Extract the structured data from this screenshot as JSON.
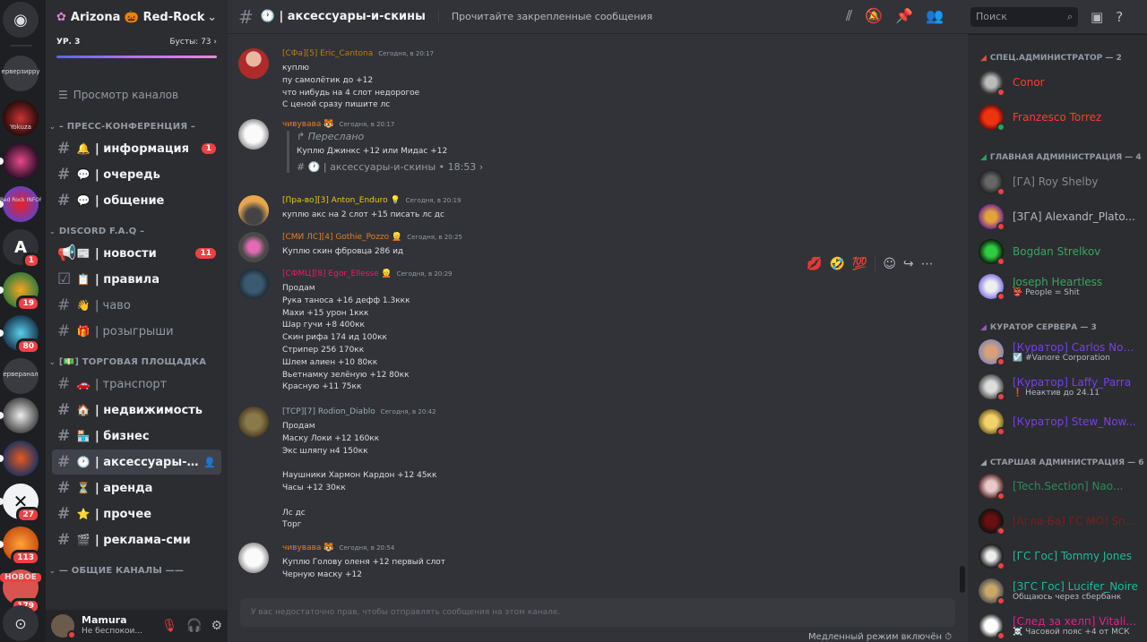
{
  "server": {
    "name": "Arizona 🎃 Red-Rock",
    "level": "УР. 3",
    "boosts": "Бусты: 73"
  },
  "rail": [
    {
      "label": "ерверзирру",
      "badge": ""
    },
    {
      "label": "Yokuza",
      "badge": ""
    },
    {
      "label": "",
      "badge": ""
    },
    {
      "label": "Red Rock INFORMAL",
      "badge": ""
    },
    {
      "label": "",
      "badge": "1"
    },
    {
      "label": "",
      "badge": "19"
    },
    {
      "label": "",
      "badge": "80"
    },
    {
      "label": "ерверанал",
      "badge": ""
    },
    {
      "label": "",
      "badge": ""
    },
    {
      "label": "",
      "badge": ""
    },
    {
      "label": "",
      "badge": "27"
    },
    {
      "label": "",
      "badge": "113"
    },
    {
      "label": "НОВОЕ",
      "badge": "179"
    }
  ],
  "sidebar": {
    "browse": "Просмотр каналов",
    "categories": [
      {
        "name": "– ПРЕСС-КОНФЕРЕНЦИЯ –"
      },
      {
        "name": "DISCORD F.A.Q –"
      },
      {
        "name": "[💵] ТОРГОВАЯ ПЛОЩАДКА"
      },
      {
        "name": "— ОБЩИЕ КАНАЛЫ ——"
      }
    ],
    "channels": [
      {
        "emoji": "🔔",
        "name": "| информация",
        "badge": "1",
        "state": "unread"
      },
      {
        "emoji": "💬",
        "name": "| очередь",
        "badge": "",
        "state": "unread"
      },
      {
        "emoji": "💬",
        "name": "| общение",
        "badge": "",
        "state": "unread"
      },
      {
        "emoji": "📰",
        "name": "| новости",
        "badge": "11",
        "state": "unread"
      },
      {
        "emoji": "📋",
        "name": "| правила",
        "badge": "",
        "state": "unread"
      },
      {
        "emoji": "👋",
        "name": "| чаво",
        "badge": "",
        "state": "read"
      },
      {
        "emoji": "🎁",
        "name": "| розыгрыши",
        "badge": "",
        "state": "read"
      },
      {
        "emoji": "🚗",
        "name": "| транспорт",
        "badge": "",
        "state": "read"
      },
      {
        "emoji": "🏠",
        "name": "| недвижимость",
        "badge": "",
        "state": "unread"
      },
      {
        "emoji": "🏪",
        "name": "| бизнес",
        "badge": "",
        "state": "unread"
      },
      {
        "emoji": "🕐",
        "name": "| аксессуары-и-...",
        "badge": "",
        "state": "active"
      },
      {
        "emoji": "⏳",
        "name": "| аренда",
        "badge": "",
        "state": "unread"
      },
      {
        "emoji": "⭐",
        "name": "| прочее",
        "badge": "",
        "state": "unread"
      },
      {
        "emoji": "🎬",
        "name": "| реклама-сми",
        "badge": "",
        "state": "unread"
      }
    ]
  },
  "user": {
    "name": "Mamura",
    "status": "Не беспокои..."
  },
  "header": {
    "channel": "🕐 | аксессуары-и-скины",
    "topic": "Прочитайте закрепленные сообщения",
    "search_placeholder": "Поиск"
  },
  "messages": [
    {
      "author": "[СФа][5] Eric_Cantona",
      "color": "#c27c0e",
      "time": "Сегодня, в 20:17",
      "lines": [
        "куплю",
        "пу самолётик до +12",
        "что нибудь на 4 слот недорогое",
        "С ценой сразу пишите лс"
      ]
    },
    {
      "author": "чивувава 🐯",
      "color": "#e67e22",
      "time": "Сегодня, в 20:17",
      "forward": {
        "label": "Переслано",
        "text": "Куплю Джинкс +12 или Мидас +12",
        "source": "# 🕐 | аксессуары-и-скины • 18:53 ›"
      }
    },
    {
      "author": "[Пра-во][3] Anton_Enduro 💡",
      "color": "#f1c40f",
      "time": "Сегодня, в 20:19",
      "lines": [
        "куплю акс на 2 слот +15 писать лс дс"
      ]
    },
    {
      "author": "[СМИ ЛС][4] Gothie_Pozzo 👱",
      "color": "#e67e22",
      "time": "Сегодня, в 20:25",
      "lines": [
        "Куплю скин фбровца 286 ид"
      ]
    },
    {
      "author": "[СФМЦ][8] Egor_Ellesse 👱",
      "color": "#e91e63",
      "time": "Сегодня, в 20:29",
      "lines": [
        "Продам",
        "Рука таноса +16 дефф 1.3ккк",
        "Махи +15 урон 1ккк",
        "Шар гучи +8 400кк",
        "Скин рифа 174 ид 100кк",
        "Стрипер 256 170кк",
        "Шлем алиен +10 80кк",
        "Вьетнамку зелёную +12 80кк",
        "Красную +11 75кк"
      ]
    },
    {
      "author": "[ТСР][7] Rodion_Diablo",
      "color": "#99aab5",
      "time": "Сегодня, в 20:42",
      "lines": [
        "Продам",
        "Маску Локи +12 160кк",
        "Экс шляпу н4 150кк",
        "",
        "Наушники Хармон Кардон +12 45кк",
        "Часы +12 30кк",
        "",
        "Лс дс",
        "Торг"
      ]
    },
    {
      "author": "чивувава 🐯",
      "color": "#e67e22",
      "time": "Сегодня, в 20:54",
      "lines": [
        "Куплю Голову оленя +12 первый слот",
        "Черную маску +12"
      ]
    }
  ],
  "reactions": [
    "💋",
    "🤣",
    "💯"
  ],
  "composer": {
    "placeholder": "У вас недостаточно прав, чтобы отправлять сообщения на этом канале.",
    "slowmode": "Медленный режим включён"
  },
  "members": {
    "categories": [
      {
        "name": "СПЕЦ.АДМИНИСТРАТОР — 2"
      },
      {
        "name": "ГЛАВНАЯ АДМИНИСТРАЦИЯ — 4"
      },
      {
        "name": "КУРАТОР СЕРВЕРА — 3"
      },
      {
        "name": "СТАРШАЯ АДМИНИСТРАЦИЯ — 6"
      }
    ],
    "list": [
      {
        "name": "Conor",
        "color": "#ff3b30",
        "status": "",
        "on": false
      },
      {
        "name": "Franzesco Torrez",
        "color": "#ff3b30",
        "status": "",
        "on": true
      },
      {
        "name": "[ГА] Roy Shelby",
        "color": "#8a8a8a",
        "status": "",
        "on": false
      },
      {
        "name": "[ЗГА] Alexandr_Plato...",
        "color": "#b5bac1",
        "status": "",
        "on": false
      },
      {
        "name": "Bogdan Strelkov",
        "color": "#3ba55d",
        "status": "",
        "on": false
      },
      {
        "name": "Joseph Heartless",
        "color": "#3ba55d",
        "status": "People = Shit",
        "on": false
      },
      {
        "name": "[Куратор] Carlos Now...",
        "color": "#7b3fe4",
        "status": "☑️ #Vanore Corporation",
        "on": false
      },
      {
        "name": "[Куратор] Laffy_Parra",
        "color": "#7b3fe4",
        "status": "❗ Неактив до 24.11",
        "on": false
      },
      {
        "name": "[Куратор] Stew_Now...",
        "color": "#7b3fe4",
        "status": "",
        "on": false
      },
      {
        "name": "[Tech.Section] Nao...",
        "color": "#2e8b57",
        "status": "",
        "on": false
      },
      {
        "name": "[Агла-Ба] ГС МО] Sn...",
        "color": "#7a1f1f",
        "status": "",
        "on": false
      },
      {
        "name": "[ГС Гос] Tommy Jones",
        "color": "#1abc9c",
        "status": "",
        "on": false
      },
      {
        "name": "[ЗГС Гос] Lucifer_Noire",
        "color": "#1abc9c",
        "status": "Общаюсь через сбербанк",
        "on": false
      },
      {
        "name": "[След за хелп] Vitalik...",
        "color": "#e91e8c",
        "status": "☠️ Часовой пояс +4 от МСК",
        "on": false
      }
    ]
  }
}
